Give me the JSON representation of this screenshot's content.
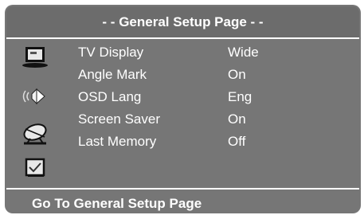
{
  "title": "- - General Setup Page - -",
  "icons": [
    {
      "name": "tv-display-icon"
    },
    {
      "name": "audio-speaker-icon"
    },
    {
      "name": "satellite-dish-icon"
    },
    {
      "name": "checkbox-icon"
    }
  ],
  "menu": {
    "items": [
      {
        "label": "TV Display",
        "value": "Wide"
      },
      {
        "label": "Angle Mark",
        "value": "On"
      },
      {
        "label": "OSD Lang",
        "value": "Eng"
      },
      {
        "label": "Screen Saver",
        "value": "On"
      },
      {
        "label": "Last Memory",
        "value": "Off"
      }
    ]
  },
  "footer": "Go To General Setup Page",
  "colors": {
    "panel": "#767676",
    "title_bar": "#6c6c6c",
    "text": "#ffffff"
  }
}
